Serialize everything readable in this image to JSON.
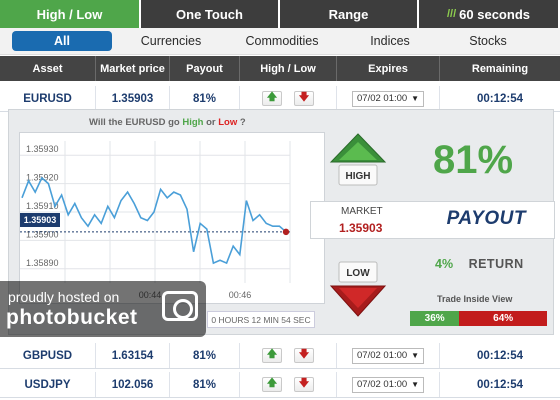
{
  "tabs": [
    {
      "label": "High / Low",
      "active": true
    },
    {
      "label": "One Touch"
    },
    {
      "label": "Range"
    },
    {
      "label": "60 seconds",
      "prefix": "///"
    }
  ],
  "filters": [
    "All",
    "Currencies",
    "Commodities",
    "Indices",
    "Stocks"
  ],
  "columns": [
    "Asset",
    "Market price",
    "Payout",
    "High / Low",
    "Expires",
    "Remaining"
  ],
  "rows": [
    {
      "asset": "EURUSD",
      "price": "1.35903",
      "payout": "81%",
      "expires": "07/02 01:00",
      "remaining": "00:12:54"
    },
    {
      "asset": "GBPUSD",
      "price": "1.63154",
      "payout": "81%",
      "expires": "07/02 01:00",
      "remaining": "00:12:54"
    },
    {
      "asset": "USDJPY",
      "price": "102.056",
      "payout": "81%",
      "expires": "07/02 01:00",
      "remaining": "00:12:54"
    }
  ],
  "panel": {
    "question_prefix": "Will the EURUSD go",
    "question_high": "High",
    "question_or": "or",
    "question_low": "Low",
    "question_suffix": "?",
    "high_label": "HIGH",
    "low_label": "LOW",
    "market_label": "MARKET",
    "market_value": "1.35903",
    "payout_label": "PAYOUT",
    "payout_pct": "81%",
    "return_pct": "4%",
    "return_label": "RETURN",
    "trade_inside_label": "Trade Inside View",
    "high_share": "36%",
    "low_share": "64%",
    "high_share_value": 36,
    "timer_text": "0 HOURS 12 MIN 54 SEC",
    "price_tag": "1.35903"
  },
  "chart_data": {
    "type": "line",
    "y_ticks": [
      "1.35930",
      "1.35920",
      "1.35910",
      "1.35900",
      "1.35890"
    ],
    "x_ticks": [
      "00:44",
      "00:46"
    ],
    "ylim": [
      1.35885,
      1.35935
    ],
    "series": [
      {
        "color": "#4a9fd8",
        "y": [
          1.35915,
          1.35921,
          1.35917,
          1.35922,
          1.3592,
          1.35912,
          1.35916,
          1.35909,
          1.35913,
          1.35908,
          1.35905,
          1.35909,
          1.35906,
          1.35912,
          1.35908,
          1.35914,
          1.35917,
          1.35913,
          1.35908,
          1.35907,
          1.3591,
          1.35918,
          1.35915,
          1.35917,
          1.35916,
          1.35911,
          1.35896,
          1.35906,
          1.35904,
          1.35892,
          1.35893,
          1.35892,
          1.35898,
          1.35895,
          1.35914,
          1.35907,
          1.35909,
          1.35906,
          1.35905,
          1.35905,
          1.35903
        ]
      }
    ],
    "current_value": 1.35903
  },
  "watermark": {
    "line1": "proudly hosted on",
    "line2": "photobucket"
  },
  "colors": {
    "green": "#4fa64a",
    "red": "#c21c1c",
    "navy": "#1d3c6e",
    "blue": "#1a6bb0"
  }
}
